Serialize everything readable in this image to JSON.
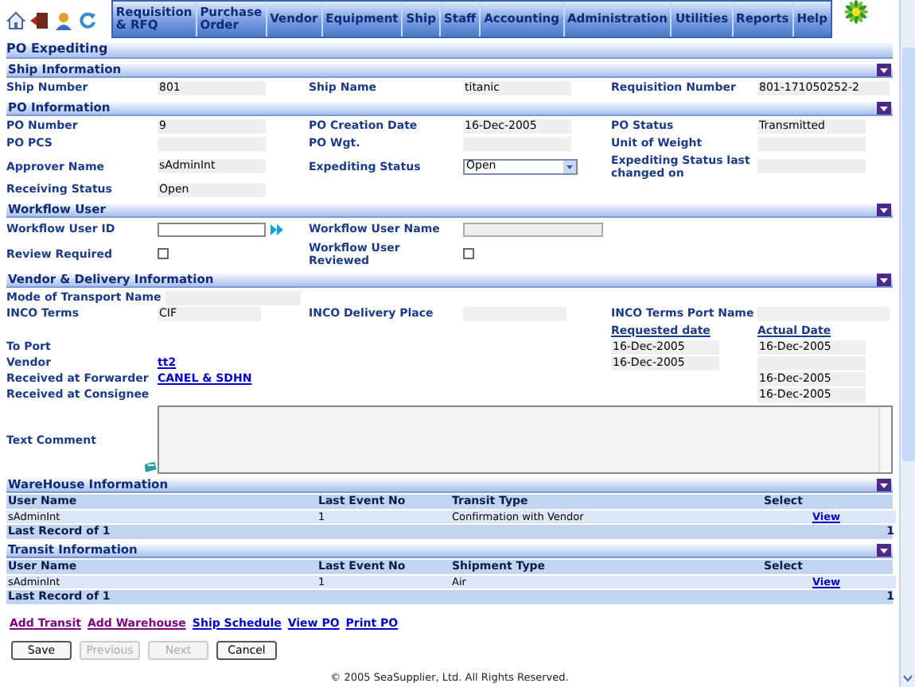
{
  "menu": [
    {
      "label": "Requisition & RFQ"
    },
    {
      "label": "Purchase Order"
    },
    {
      "label": "Vendor"
    },
    {
      "label": "Equipment"
    },
    {
      "label": "Ship"
    },
    {
      "label": "Staff"
    },
    {
      "label": "Accounting"
    },
    {
      "label": "Administration"
    },
    {
      "label": "Utilities"
    },
    {
      "label": "Reports"
    },
    {
      "label": "Help"
    }
  ],
  "page_title": "PO Expediting",
  "ship_information": {
    "title": "Ship Information",
    "expanded": true,
    "fields": [
      {
        "label": "Ship Number",
        "value": "801"
      },
      {
        "label": "Ship Name",
        "value": "titanic"
      },
      {
        "label": "Requisition Number",
        "value": "801-171050252-2"
      }
    ]
  },
  "po_information": {
    "title": "PO Information",
    "expanded": true,
    "fields": [
      {
        "label": "PO Number",
        "value": "9",
        "kind": "text"
      },
      {
        "label": "PO Creation Date",
        "value": "16-Dec-2005",
        "kind": "text"
      },
      {
        "label": "PO Status",
        "value": "Transmitted",
        "kind": "text"
      },
      {
        "label": "PO PCS",
        "kind": "text"
      },
      {
        "label": "PO Wgt.",
        "kind": "text"
      },
      {
        "label": "Unit of Weight",
        "kind": "text"
      },
      {
        "label": "Approver Name",
        "value": "sAdminInt",
        "kind": "text"
      },
      {
        "label": "Expediting Status",
        "value": "Open",
        "kind": "select"
      },
      {
        "label": "Expediting Status last changed on",
        "kind": "text"
      },
      {
        "label": "Receiving Status",
        "value": "Open",
        "kind": "text"
      }
    ]
  },
  "workflow_user": {
    "title": "Workflow User",
    "expanded": true,
    "fields": [
      {
        "label": "Workflow User ID",
        "kind": "input"
      },
      {
        "label": "Workflow User Name",
        "kind": "readonly"
      },
      {
        "label": "Review Required",
        "kind": "checkbox",
        "checked": false
      },
      {
        "label": "Workflow User Reviewed",
        "kind": "checkbox",
        "checked": false
      }
    ]
  },
  "vendor_delivery": {
    "title": "Vendor & Delivery Information",
    "expanded": true,
    "mode_of_transport": {
      "label": "Mode of Transport Name"
    },
    "inco": [
      {
        "label": "INCO Terms",
        "value": "CIF"
      },
      {
        "label": "INCO Delivery Place"
      },
      {
        "label": "INCO Terms Port Name"
      }
    ],
    "date_columns": [
      "Requested date",
      "Actual Date"
    ],
    "rows": [
      {
        "label": "To Port",
        "requested": "16-Dec-2005",
        "actual": "16-Dec-2005"
      },
      {
        "label": "Vendor",
        "link": "tt2",
        "requested": "16-Dec-2005",
        "actual_box": true
      },
      {
        "label": "Received at Forwarder",
        "link": "CANEL & SDHN",
        "actual": "16-Dec-2005"
      },
      {
        "label": "Received at Consignee",
        "actual": "16-Dec-2005"
      }
    ],
    "comment_label": "Text Comment"
  },
  "tables": [
    {
      "title": "WareHouse Information",
      "expanded": true,
      "columns": [
        "User Name",
        "Last Event No",
        "Transit Type",
        "Select"
      ],
      "rows": [
        {
          "cells": [
            "sAdminInt",
            "1",
            "Confirmation with Vendor"
          ],
          "link": "View"
        }
      ],
      "footer": "Last Record of 1",
      "footer_count": "1"
    },
    {
      "title": "Transit Information",
      "expanded": true,
      "columns": [
        "User Name",
        "Last Event No",
        "Shipment Type",
        "Select"
      ],
      "rows": [
        {
          "cells": [
            "sAdminInt",
            "1",
            "Air"
          ],
          "link": "View"
        }
      ],
      "footer": "Last Record of 1",
      "footer_count": "1"
    }
  ],
  "links": [
    {
      "label": "Add Transit",
      "visited": true
    },
    {
      "label": "Add Warehouse",
      "visited": true
    },
    {
      "label": "Ship Schedule",
      "visited": false
    },
    {
      "label": "View PO",
      "visited": false
    },
    {
      "label": "Print PO",
      "visited": false
    }
  ],
  "buttons": [
    {
      "label": "Save",
      "disabled": false
    },
    {
      "label": "Previous",
      "disabled": true
    },
    {
      "label": "Next",
      "disabled": true
    },
    {
      "label": "Cancel",
      "disabled": false
    }
  ],
  "copyright": "© 2005 SeaSupplier, Ltd. All Rights Reserved."
}
